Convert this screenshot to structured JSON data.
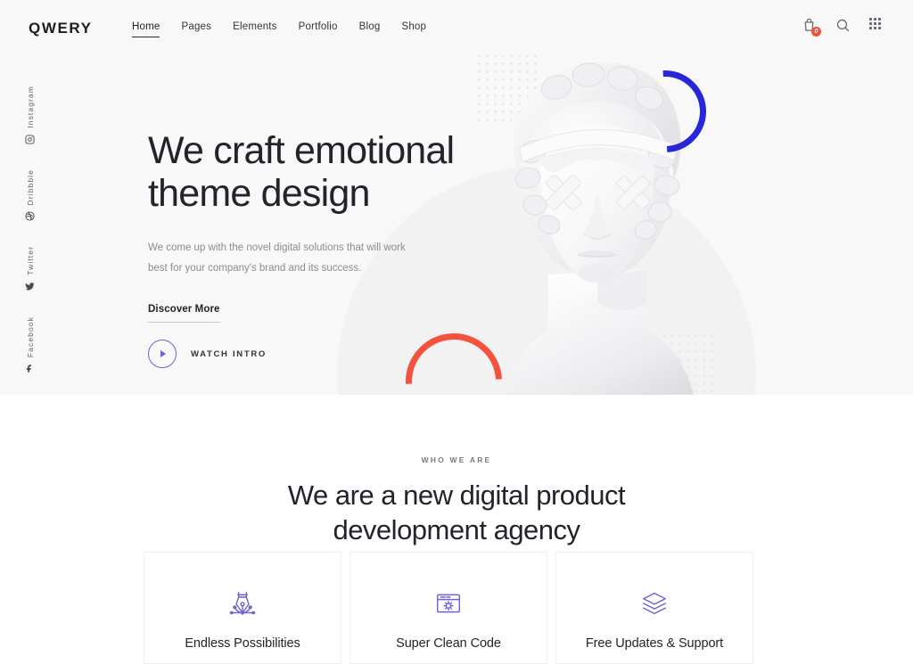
{
  "brand": {
    "logo": "QWERY"
  },
  "nav": {
    "items": [
      {
        "label": "Home",
        "active": true
      },
      {
        "label": "Pages",
        "active": false
      },
      {
        "label": "Elements",
        "active": false
      },
      {
        "label": "Portfolio",
        "active": false
      },
      {
        "label": "Blog",
        "active": false
      },
      {
        "label": "Shop",
        "active": false
      }
    ]
  },
  "header_actions": {
    "cart": {
      "icon": "shopping-bag-icon",
      "badge": "0"
    },
    "search": {
      "icon": "search-icon"
    },
    "grid": {
      "icon": "grid-menu-icon"
    }
  },
  "social": {
    "items": [
      {
        "label": "Instagram",
        "icon": "instagram-icon"
      },
      {
        "label": "Dribbble",
        "icon": "dribbble-icon"
      },
      {
        "label": "Twitter",
        "icon": "twitter-icon"
      },
      {
        "label": "Facebook",
        "icon": "facebook-icon"
      }
    ]
  },
  "hero": {
    "title_line1": "We craft emotional",
    "title_line2": "theme design",
    "subtitle": "We come up with the novel digital solutions that will work best for your company's brand and its success.",
    "cta_primary": "Discover More",
    "cta_video": "WATCH INTRO",
    "decor": {
      "arc_blue_color": "#2727d8",
      "arc_red_color": "#f4523c",
      "background_color": "#f8f8f8"
    }
  },
  "about": {
    "eyebrow": "WHO WE ARE",
    "title_line1": "We are a new digital product",
    "title_line2": "development agency"
  },
  "features": {
    "accent_color": "#6b63d6",
    "cards": [
      {
        "title": "Endless Possibilities",
        "icon": "pen-tool-icon"
      },
      {
        "title": "Super Clean Code",
        "icon": "browser-gear-icon"
      },
      {
        "title": "Free Updates & Support",
        "icon": "layers-icon"
      }
    ]
  }
}
